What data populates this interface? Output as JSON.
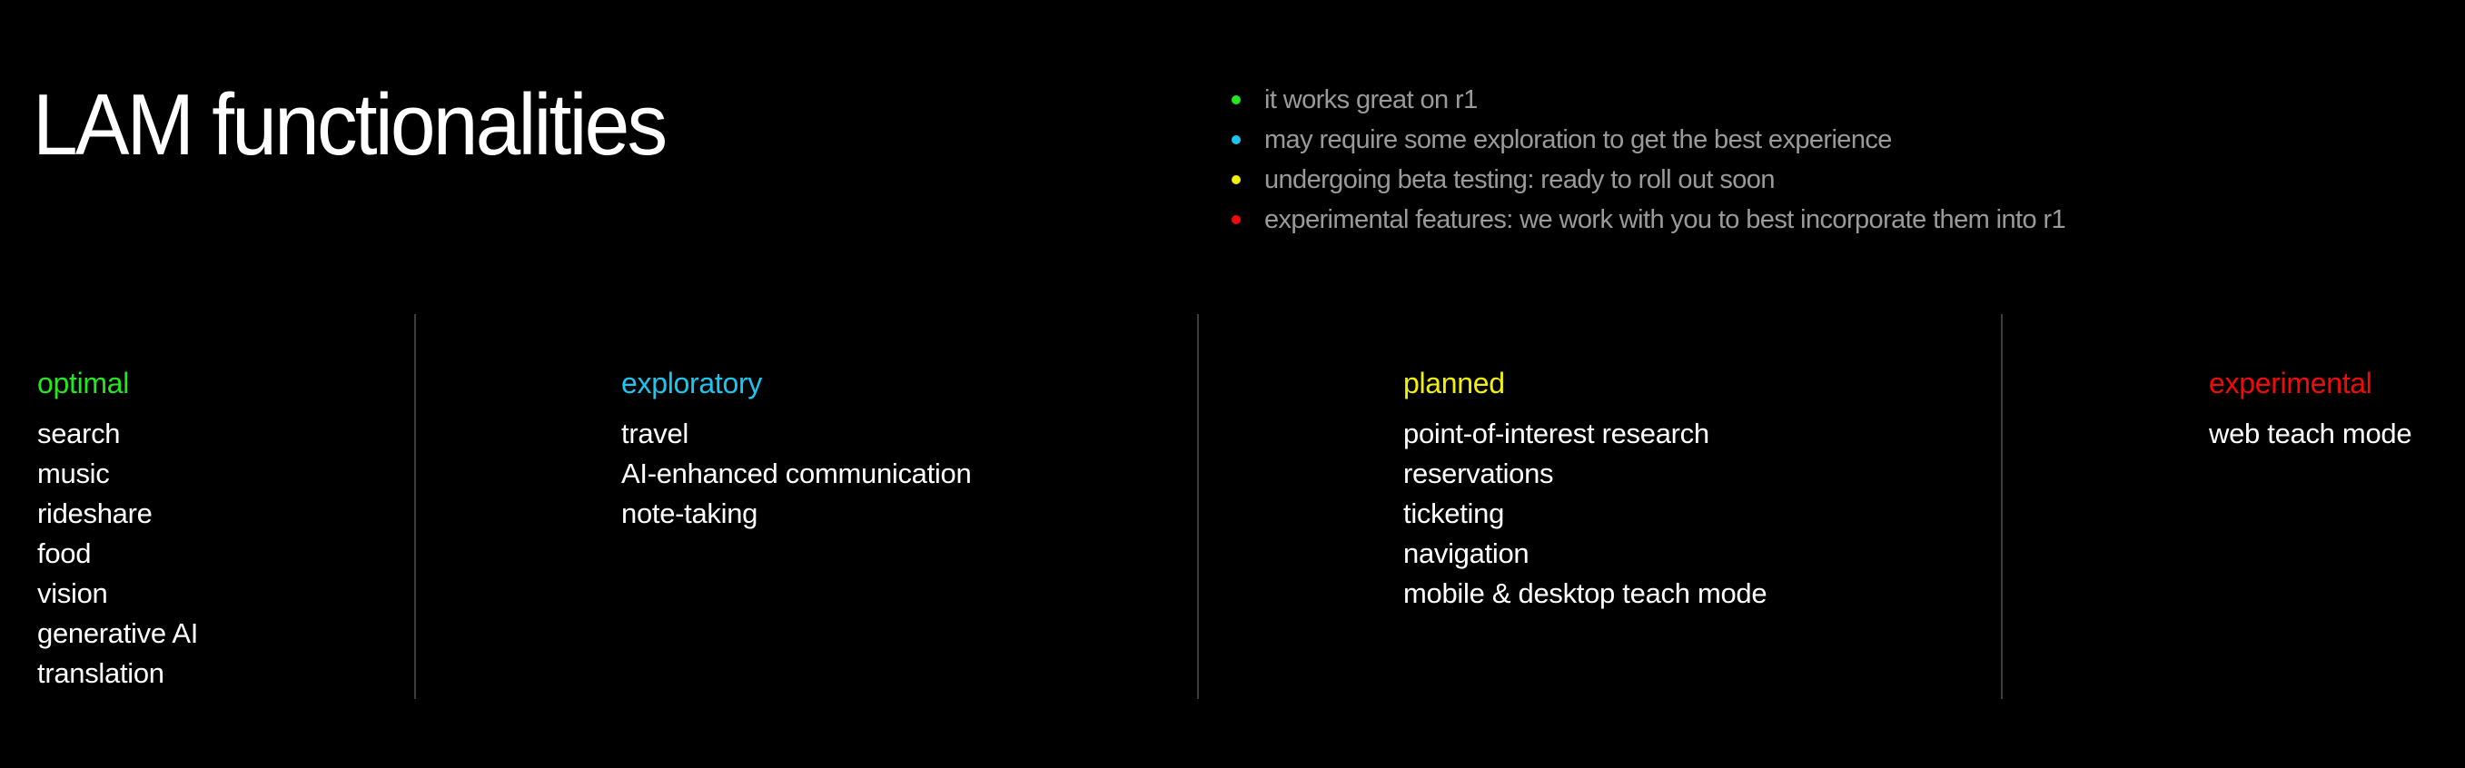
{
  "title": "LAM functionalities",
  "legend": [
    {
      "color": "#22e81e",
      "text": "it works great on r1",
      "icon": "green-dot-icon"
    },
    {
      "color": "#1cc6ee",
      "text": "may require some exploration to get the best experience",
      "icon": "cyan-dot-icon"
    },
    {
      "color": "#f0f00a",
      "text": "undergoing beta testing: ready to roll out soon",
      "icon": "yellow-dot-icon"
    },
    {
      "color": "#f00a0a",
      "text": "experimental features: we work with you to best incorporate them into r1",
      "icon": "red-dot-icon"
    }
  ],
  "columns": [
    {
      "header": "optimal",
      "color": "#22e81e",
      "items": [
        "search",
        "music",
        "rideshare",
        "food",
        "vision",
        "generative AI",
        "translation"
      ]
    },
    {
      "header": "exploratory",
      "color": "#1cc6ee",
      "items": [
        "travel",
        "AI-enhanced communication",
        "note-taking"
      ]
    },
    {
      "header": "planned",
      "color": "#f0f00a",
      "items": [
        "point-of-interest research",
        "reservations",
        "ticketing",
        "navigation",
        "mobile & desktop teach mode"
      ]
    },
    {
      "header": "experimental",
      "color": "#f00a0a",
      "items": [
        "web teach mode"
      ]
    }
  ]
}
